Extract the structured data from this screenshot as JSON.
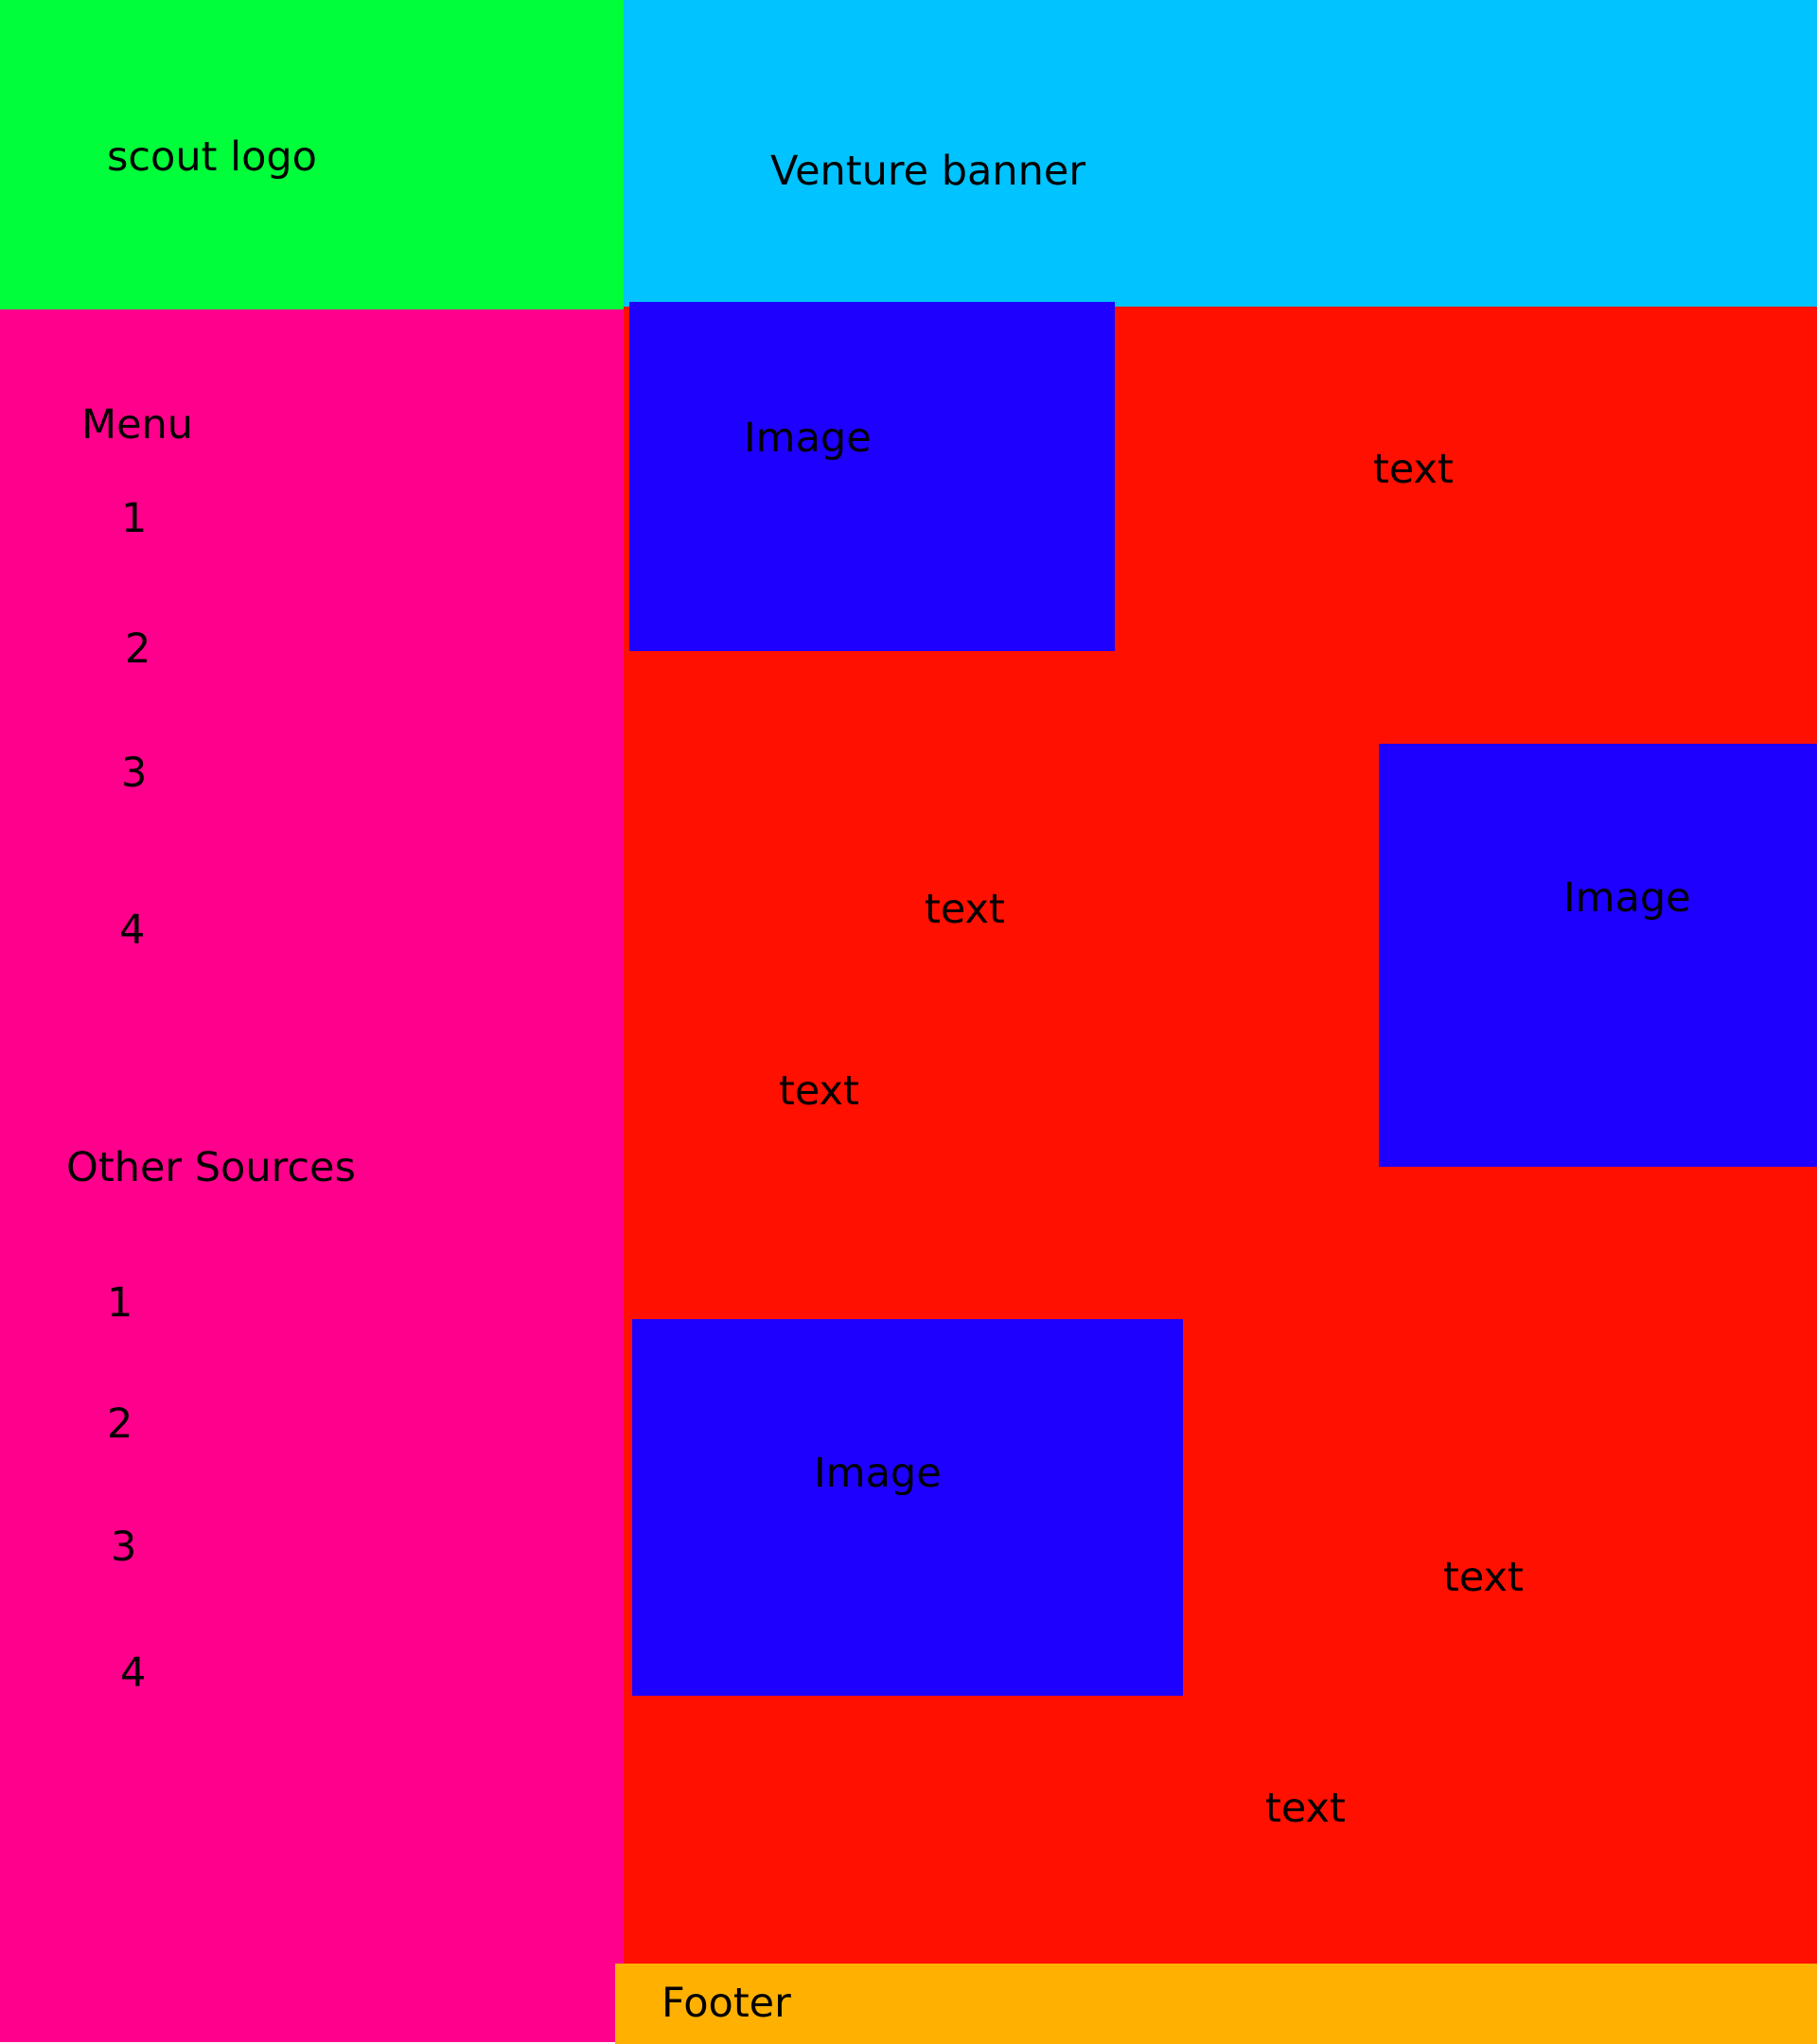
{
  "colors": {
    "logo_bg": "#00ff3a",
    "banner_bg": "#00c3ff",
    "sidebar_bg": "#ff008c",
    "content_bg": "#ff1000",
    "image_bg": "#1e00ff",
    "footer_bg": "#ffb000",
    "text": "#000000"
  },
  "header": {
    "logo_label": "scout logo",
    "banner_label": "Venture banner"
  },
  "sidebar": {
    "menu_title": "Menu",
    "menu_items": [
      "1",
      "2",
      "3",
      "4"
    ],
    "other_title": "Other Sources",
    "other_items": [
      "1",
      "2",
      "3",
      "4"
    ]
  },
  "content": {
    "images": [
      {
        "label": "Image"
      },
      {
        "label": "Image"
      },
      {
        "label": "Image"
      }
    ],
    "texts": [
      "text",
      "text",
      "text",
      "text",
      "text"
    ]
  },
  "footer": {
    "label": "Footer"
  }
}
